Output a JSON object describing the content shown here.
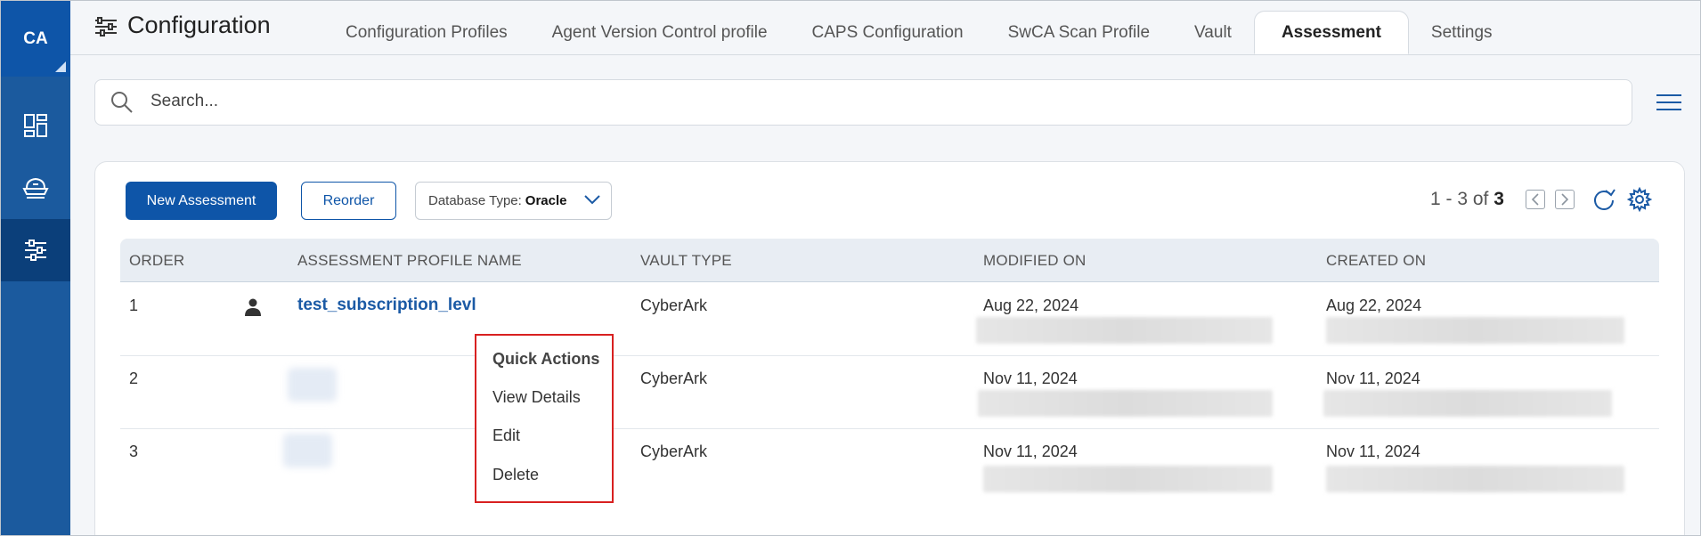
{
  "rail": {
    "logo": "CA"
  },
  "header": {
    "title": "Configuration",
    "tabs": [
      {
        "label": "Configuration Profiles"
      },
      {
        "label": "Agent Version Control profile"
      },
      {
        "label": "CAPS Configuration"
      },
      {
        "label": "SwCA Scan Profile"
      },
      {
        "label": "Vault"
      },
      {
        "label": "Assessment",
        "active": true
      },
      {
        "label": "Settings"
      }
    ]
  },
  "search": {
    "placeholder": "Search..."
  },
  "toolbar": {
    "new_label": "New Assessment",
    "reorder_label": "Reorder",
    "dbtype_label": "Database Type:",
    "dbtype_value": "Oracle"
  },
  "pager": {
    "range": "1 - 3 of",
    "total": "3"
  },
  "table": {
    "columns": [
      "ORDER",
      "ASSESSMENT PROFILE NAME",
      "VAULT TYPE",
      "MODIFIED ON",
      "CREATED ON"
    ],
    "rows": [
      {
        "order": "1",
        "name": "test_subscription_levl",
        "vault": "CyberArk",
        "modified": "Aug 22, 2024",
        "created": "Aug 22, 2024"
      },
      {
        "order": "2",
        "name": "",
        "vault": "CyberArk",
        "modified": "Nov 11, 2024",
        "created": "Nov 11, 2024"
      },
      {
        "order": "3",
        "name": "",
        "vault": "CyberArk",
        "modified": "Nov 11, 2024",
        "created": "Nov 11, 2024"
      }
    ]
  },
  "quick_actions": {
    "title": "Quick Actions",
    "items": [
      "View Details",
      "Edit",
      "Delete"
    ]
  },
  "colors": {
    "primary": "#0e55a8",
    "rail": "#1b5a9e",
    "highlight": "#d82020"
  }
}
